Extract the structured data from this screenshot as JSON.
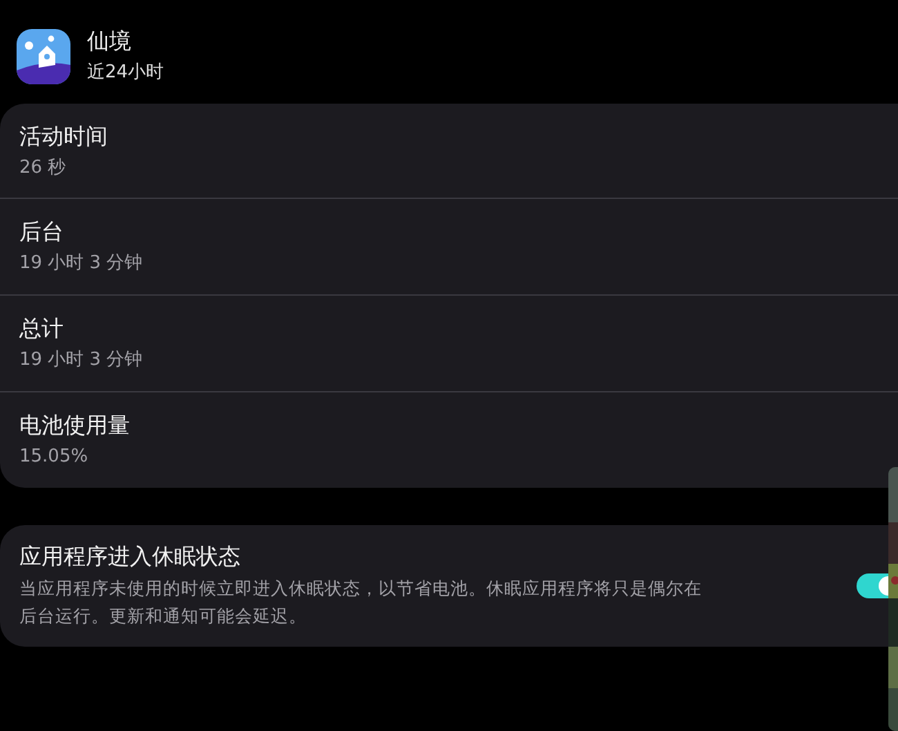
{
  "app": {
    "name": "仙境",
    "period": "近24小时"
  },
  "usage": [
    {
      "label": "活动时间",
      "value": "26 秒"
    },
    {
      "label": "后台",
      "value": "19 小时 3 分钟"
    },
    {
      "label": "总计",
      "value": "19 小时 3 分钟"
    },
    {
      "label": "电池使用量",
      "value": "15.05%"
    }
  ],
  "sleep_setting": {
    "title": "应用程序进入休眠状态",
    "description": "当应用程序未使用的时候立即进入休眠状态，以节省电池。休眠应用程序将只是偶尔在后台运行。更新和通知可能会延迟。",
    "on": true
  }
}
